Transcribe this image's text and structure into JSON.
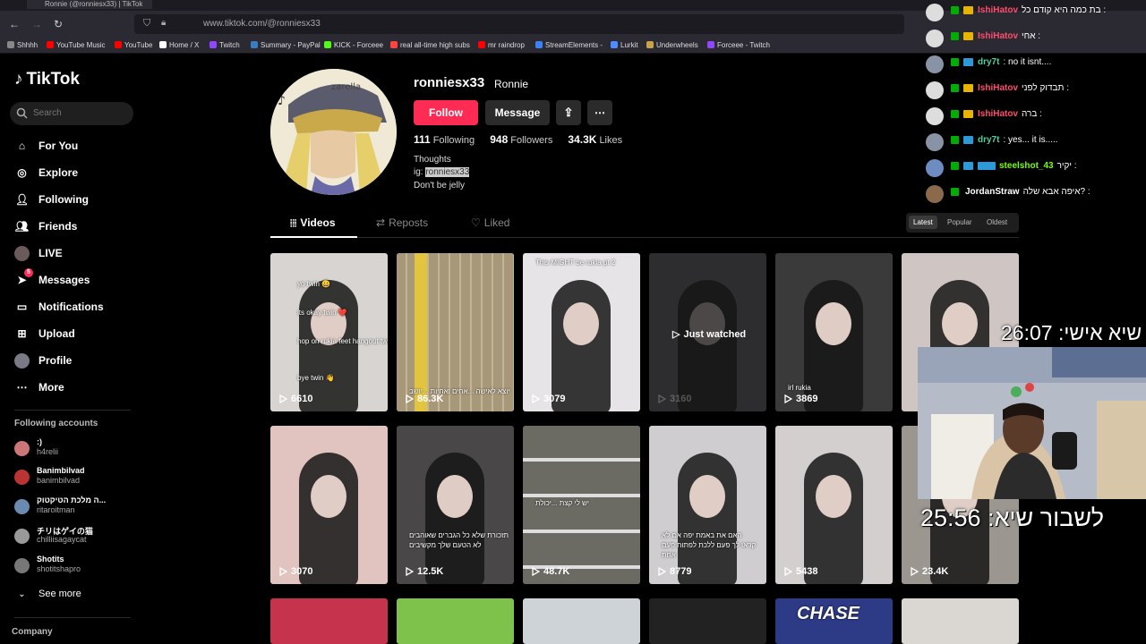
{
  "browser": {
    "tab_title": "Ronnie (@ronniesx33) | TikTok",
    "url": "www.tiktok.com/@ronniesx33",
    "bookmarks": [
      {
        "label": "Shhhh",
        "color": "#888888"
      },
      {
        "label": "YouTube Music",
        "color": "#ff0000"
      },
      {
        "label": "YouTube",
        "color": "#ff0000"
      },
      {
        "label": "Home / X",
        "color": "#ffffff"
      },
      {
        "label": "Twitch",
        "color": "#9146ff"
      },
      {
        "label": "Summary - PayPal",
        "color": "#3b7bbf"
      },
      {
        "label": "KICK - Forceee",
        "color": "#53fc18"
      },
      {
        "label": "real all-time high subs",
        "color": "#ff4444"
      },
      {
        "label": "mr raindrop",
        "color": "#ff0000"
      },
      {
        "label": "StreamElements -",
        "color": "#3b82f6"
      },
      {
        "label": "Lurkit",
        "color": "#4f8cff"
      },
      {
        "label": "Underwheels",
        "color": "#c9a14a"
      },
      {
        "label": "Forceee - Twitch",
        "color": "#9146ff"
      }
    ]
  },
  "sidebar": {
    "logo": "TikTok",
    "search_placeholder": "Search",
    "nav": [
      {
        "label": "For You",
        "icon": "home-icon"
      },
      {
        "label": "Explore",
        "icon": "compass-icon"
      },
      {
        "label": "Following",
        "icon": "user-follow-icon"
      },
      {
        "label": "Friends",
        "icon": "friends-icon"
      },
      {
        "label": "LIVE",
        "icon": "live-icon"
      },
      {
        "label": "Messages",
        "icon": "paper-plane-icon",
        "badge": "5"
      },
      {
        "label": "Notifications",
        "icon": "chat-bubble-icon"
      },
      {
        "label": "Upload",
        "icon": "plus-square-icon"
      },
      {
        "label": "Profile",
        "icon": "profile-avatar-icon"
      },
      {
        "label": "More",
        "icon": "ellipsis-icon"
      }
    ],
    "following_title": "Following accounts",
    "accounts": [
      {
        "name": ":)",
        "handle": "h4relii"
      },
      {
        "name": "Banimbilvad",
        "handle": "banimbilvad"
      },
      {
        "name": "ה מלכת הטיקטוק...",
        "handle": "ritaroitman"
      },
      {
        "name": "チリはゲイの猫",
        "handle": "chilliisagaycat"
      },
      {
        "name": "Shotits",
        "handle": "shotitshapro"
      }
    ],
    "see_more": "See more",
    "company": "Company"
  },
  "profile": {
    "username": "ronniesx33",
    "display_name": "Ronnie",
    "follow_label": "Follow",
    "message_label": "Message",
    "following_count": "111",
    "following_label": "Following",
    "followers_count": "948",
    "followers_label": "Followers",
    "likes_count": "34.3K",
    "likes_label": "Likes",
    "bio_line1": "Thoughts",
    "bio_ig_prefix": "ig:",
    "bio_ig_handle": "ronniesx33",
    "bio_line3": "Don't be jelly"
  },
  "tabs": {
    "videos": "Videos",
    "reposts": "Reposts",
    "liked": "Liked"
  },
  "sort": {
    "latest": "Latest",
    "popular": "Popular",
    "oldest": "Oldest"
  },
  "videos": [
    {
      "views": "6610",
      "bg": "#d8d4d2",
      "captions": [
        "yo twin 😀",
        "its okay twin ❤️",
        "hop on rukia feet hangout twin 😂",
        "bye twin 👋"
      ]
    },
    {
      "views": "86.3K",
      "bg": "#b8a98a",
      "captions": [
        "יוצא לאישה ...אחים ואחיות ...יושב"
      ]
    },
    {
      "views": "3079",
      "bg": "#e7e4e8",
      "captions": [
        "This MIGHT be rukia pt 2"
      ]
    },
    {
      "views": "3160",
      "bg": "#2d2d2f",
      "captions": [],
      "just_watched": "Just watched"
    },
    {
      "views": "3869",
      "bg": "#3a3a3a",
      "captions": [
        "irl rukia"
      ]
    },
    {
      "views": "",
      "bg": "#cfc6c4",
      "captions": []
    },
    {
      "views": "3070",
      "bg": "#e1c3c0",
      "captions": []
    },
    {
      "views": "12.5K",
      "bg": "#4a4748",
      "captions": [
        "תזכורת שלא כל הגברים שאוהבים",
        "לא הטעם שלך מקשיבים"
      ]
    },
    {
      "views": "48.7K",
      "bg": "#6b6a63",
      "captions": [
        "יש לי קצת ...יכולת"
      ]
    },
    {
      "views": "8779",
      "bg": "#cfcdd0",
      "captions": [
        "האם את באמת יפה אם לא",
        "קראו לך פעם ללכת לפתוח פעם",
        "אחת"
      ]
    },
    {
      "views": "5438",
      "bg": "#d4cfcf",
      "captions": []
    },
    {
      "views": "23.4K",
      "bg": "#9b9690",
      "captions": []
    },
    {
      "views": "",
      "bg": "#c5334d",
      "captions": []
    },
    {
      "views": "",
      "bg": "#7fc24b",
      "captions": []
    },
    {
      "views": "",
      "bg": "#cdd3d6",
      "captions": []
    },
    {
      "views": "",
      "bg": "#222222",
      "captions": []
    },
    {
      "views": "",
      "bg": "#2d3b86",
      "captions": [
        "CHASE"
      ]
    },
    {
      "views": "",
      "bg": "#dad7d2",
      "captions": []
    }
  ],
  "chat": [
    {
      "user": "IshiHatov",
      "color": "#ff4d6d",
      "msg": "בת כמה היא קודם כל :"
    },
    {
      "user": "IshiHatov",
      "color": "#ff4d6d",
      "msg": "אחי :"
    },
    {
      "user": "dry7t",
      "color": "#4fd1a1",
      "msg": ": no it isnt...."
    },
    {
      "user": "IshiHatov",
      "color": "#ff4d6d",
      "msg": "תבדוק לפני :"
    },
    {
      "user": "IshiHatov",
      "color": "#ff4d6d",
      "msg": "ברה :"
    },
    {
      "user": "dry7t",
      "color": "#4fd1a1",
      "msg": ": yes... it is....."
    },
    {
      "user": "steelshot_43",
      "color": "#7cfc00",
      "msg": "יקיר :"
    },
    {
      "user": "JordanStraw",
      "color": "#ffffff",
      "msg": "איפה אבא שלה? :"
    }
  ],
  "overlay": {
    "timer1": "שיא אישי: 26:07",
    "timer2": "לשבור שיא: 25:56"
  }
}
